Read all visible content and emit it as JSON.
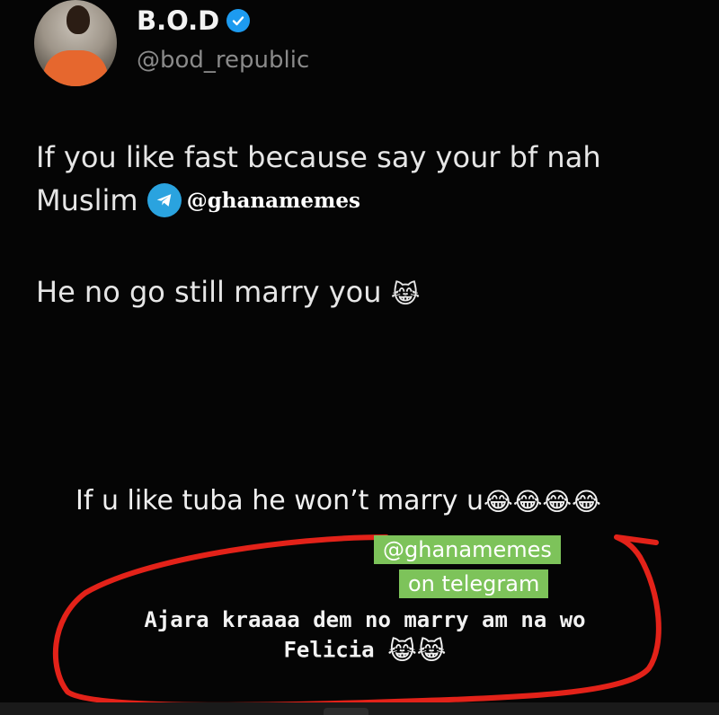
{
  "post": {
    "author_name": "B.O.D",
    "author_handle": "@bod_republic",
    "line1": "If you like fast because say your bf nah",
    "line2": "Muslim",
    "line3": "He no go still marry you",
    "line3_emoji": "😹",
    "watermark": "@ghanamemes"
  },
  "comment": {
    "text": "If u like tuba he won’t marry u",
    "emojis": "😂😂😂😂"
  },
  "reply_sticker": {
    "line1": "@ghanamemes",
    "line2": "on telegram"
  },
  "reply": {
    "line1": "Ajara kraaaa dem no marry am na wo",
    "line2": "Felicia",
    "emojis": "😹😹"
  },
  "colors": {
    "verified_badge": "#1d9bf0",
    "telegram": "#2aa3df",
    "sticker_green": "#7dc35a",
    "circle_red": "#e32219"
  },
  "icons": {
    "verified": "verified-badge-icon",
    "telegram": "telegram-icon"
  }
}
